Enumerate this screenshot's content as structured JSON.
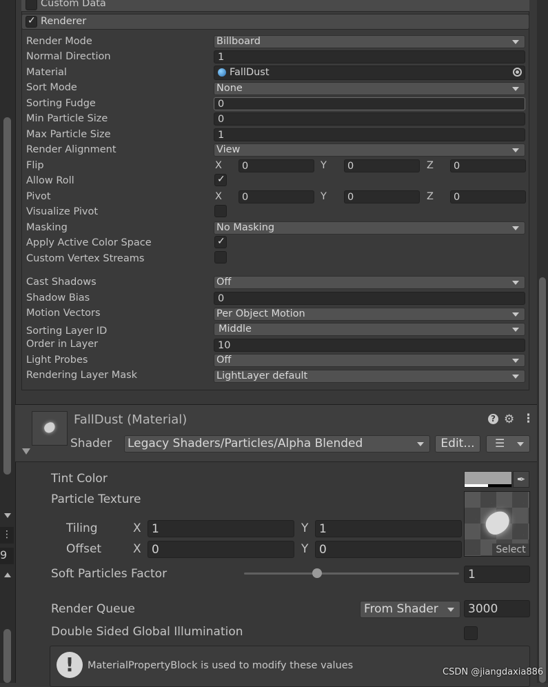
{
  "sections": {
    "custom_data": {
      "label": "Custom Data"
    },
    "renderer": {
      "label": "Renderer"
    }
  },
  "renderer": {
    "render_mode": {
      "label": "Render Mode",
      "value": "Billboard"
    },
    "normal_direction": {
      "label": "Normal Direction",
      "value": "1"
    },
    "material": {
      "label": "Material",
      "value": "FallDust"
    },
    "sort_mode": {
      "label": "Sort Mode",
      "value": "None"
    },
    "sorting_fudge": {
      "label": "Sorting Fudge",
      "value": "0"
    },
    "min_particle_size": {
      "label": "Min Particle Size",
      "value": "0"
    },
    "max_particle_size": {
      "label": "Max Particle Size",
      "value": "1"
    },
    "render_alignment": {
      "label": "Render Alignment",
      "value": "View"
    },
    "flip": {
      "label": "Flip",
      "x": "0",
      "y": "0",
      "z": "0"
    },
    "allow_roll": {
      "label": "Allow Roll"
    },
    "pivot": {
      "label": "Pivot",
      "x": "0",
      "y": "0",
      "z": "0"
    },
    "visualize_pivot": {
      "label": "Visualize Pivot"
    },
    "masking": {
      "label": "Masking",
      "value": "No Masking"
    },
    "apply_active_color_space": {
      "label": "Apply Active Color Space"
    },
    "custom_vertex_streams": {
      "label": "Custom Vertex Streams"
    },
    "cast_shadows": {
      "label": "Cast Shadows",
      "value": "Off"
    },
    "shadow_bias": {
      "label": "Shadow Bias",
      "value": "0"
    },
    "motion_vectors": {
      "label": "Motion Vectors",
      "value": "Per Object Motion"
    },
    "sorting_layer_id": {
      "label": "Sorting Layer ID",
      "value": "Middle"
    },
    "order_in_layer": {
      "label": "Order in Layer",
      "value": "10"
    },
    "light_probes": {
      "label": "Light Probes",
      "value": "Off"
    },
    "rendering_layer_mask": {
      "label": "Rendering Layer Mask",
      "value": "LightLayer default"
    }
  },
  "axes": {
    "x": "X",
    "y": "Y",
    "z": "Z"
  },
  "material_panel": {
    "title": "FallDust (Material)",
    "shader_label": "Shader",
    "shader_value": "Legacy Shaders/Particles/Alpha Blended",
    "edit_button": "Edit...",
    "tint_color": {
      "label": "Tint Color"
    },
    "particle_texture": {
      "label": "Particle Texture",
      "select": "Select"
    },
    "tiling": {
      "label": "Tiling",
      "x": "1",
      "y": "1"
    },
    "offset": {
      "label": "Offset",
      "x": "0",
      "y": "0"
    },
    "soft_particles": {
      "label": "Soft Particles Factor",
      "value": "1",
      "slider_fraction": 0.34
    },
    "render_queue": {
      "label": "Render Queue",
      "mode": "From Shader",
      "value": "3000"
    },
    "double_sided_gi": {
      "label": "Double Sided Global Illumination"
    },
    "info_message": "MaterialPropertyBlock is used to modify these values"
  },
  "left_strip": {
    "number": "9"
  },
  "watermark": "CSDN @jiangdaxia886"
}
